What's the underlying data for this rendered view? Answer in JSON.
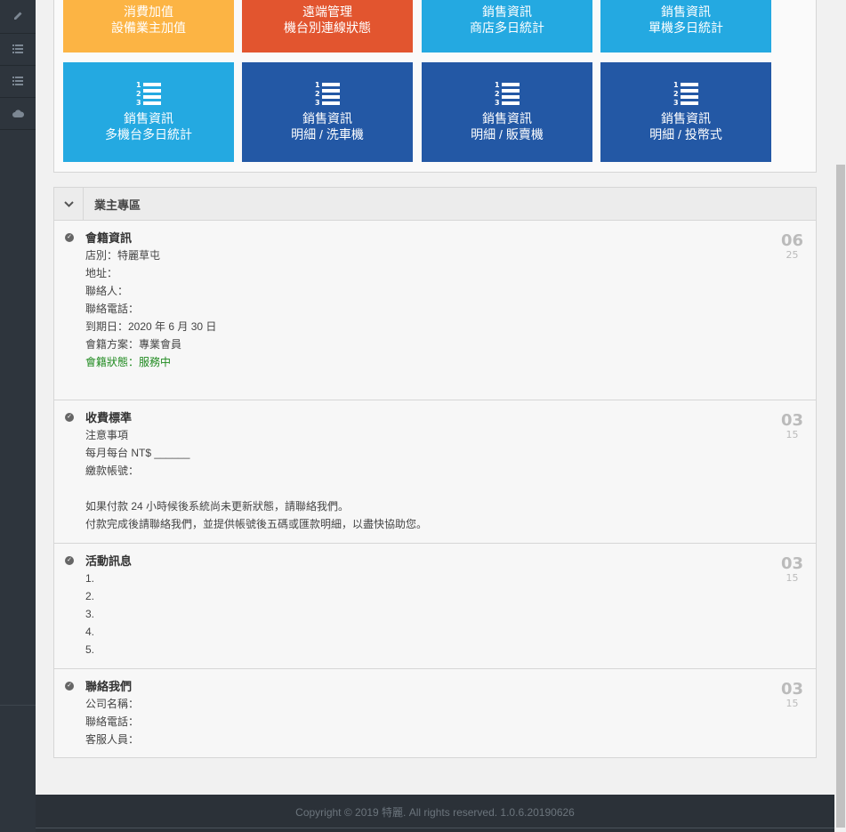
{
  "sidebar": {
    "icons": [
      "pencil-icon",
      "list-icon",
      "list-icon",
      "cloud-icon"
    ]
  },
  "tiles": [
    {
      "line1": "消費加值",
      "line2": "設備業主加值",
      "color": "#fcb444",
      "icon": null
    },
    {
      "line1": "遠端管理",
      "line2": "機台別連線狀態",
      "color": "#e2552f",
      "icon": null
    },
    {
      "line1": "銷售資訊",
      "line2": "商店多日統計",
      "color": "#24a9e1",
      "icon": null
    },
    {
      "line1": "銷售資訊",
      "line2": "單機多日統計",
      "color": "#24a9e1",
      "icon": null
    },
    {
      "line1": "銷售資訊",
      "line2": "多機台多日統計",
      "color": "#24a9e1",
      "icon": "ordered-list-icon"
    },
    {
      "line1": "銷售資訊",
      "line2": "明細 / 洗車機",
      "color": "#2358a5",
      "icon": "ordered-list-icon"
    },
    {
      "line1": "銷售資訊",
      "line2": "明細 / 販賣機",
      "color": "#2358a5",
      "icon": "ordered-list-icon"
    },
    {
      "line1": "銷售資訊",
      "line2": "明細 / 投幣式",
      "color": "#2358a5",
      "icon": "ordered-list-icon"
    }
  ],
  "owner_section": {
    "title": "業主專區",
    "items": [
      {
        "title": "會籍資訊",
        "lines": [
          "店別：特麗草屯",
          "地址：",
          "聯絡人：",
          "聯絡電話：",
          "到期日：2020 年 6 月 30 日",
          "會籍方案：專業會員"
        ],
        "status": "會籍狀態：服務中",
        "day": "06",
        "month": "25"
      },
      {
        "title": "收費標準",
        "lines": [
          "注意事項",
          "每月每台 NT$ ______",
          "繳款帳號：",
          "",
          "如果付款 24 小時候後系統尚未更新狀態，請聯絡我們。",
          "付款完成後請聯絡我們，並提供帳號後五碼或匯款明細，以盡快協助您。"
        ],
        "day": "03",
        "month": "15"
      },
      {
        "title": "活動訊息",
        "lines": [
          "1.",
          "2.",
          "3.",
          "4.",
          "5."
        ],
        "day": "03",
        "month": "15"
      },
      {
        "title": "聯絡我們",
        "lines": [
          "公司名稱：",
          "聯絡電話：",
          "客服人員："
        ],
        "day": "03",
        "month": "15"
      }
    ]
  },
  "footer": {
    "text": "Copyright © 2019 特麗. All rights reserved. 1.0.6.20190626"
  },
  "colors": {
    "status_green": "#1f8a1f",
    "sidebar_bg": "#2e353d"
  }
}
